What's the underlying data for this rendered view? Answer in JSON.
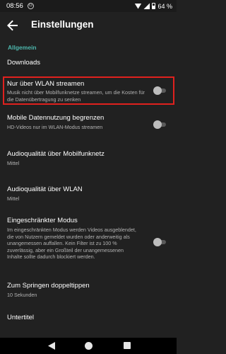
{
  "status_bar": {
    "time": "08:56",
    "notification_badge": "G",
    "battery_percent": "64 %",
    "icons": [
      "wifi-icon",
      "signal-icon",
      "battery-icon"
    ]
  },
  "app_bar": {
    "back_icon": "arrow-left-icon",
    "title": "Einstellungen"
  },
  "section": {
    "header": "Allgemein",
    "header_color": "#4db6ac"
  },
  "items": [
    {
      "title": "Downloads"
    },
    {
      "title": "Nur über WLAN streamen",
      "subtitle": "Musik nicht über Mobilfunknetze streamen, um die Kosten für die Datenübertragung zu senken",
      "toggle": false,
      "highlighted": true
    },
    {
      "title": "Mobile Datennutzung begrenzen",
      "subtitle": "HD-Videos nur im WLAN-Modus streamen",
      "toggle": false
    },
    {
      "title": "Audioqualität über Mobilfunknetz",
      "subtitle": "Mittel"
    },
    {
      "title": "Audioqualität über WLAN",
      "subtitle": "Mittel"
    },
    {
      "title": "Eingeschränkter Modus",
      "subtitle": "Im eingeschränkten Modus werden Videos ausgeblendet, die von Nutzern gemeldet wurden oder anderweitig als unangemessen auffallen. Kein Filter ist zu 100 % zuverlässig, aber ein Großteil der unangemessenen Inhalte sollte dadurch blockiert werden.",
      "toggle": false
    },
    {
      "title": "Zum Springen doppeltippen",
      "subtitle": "10 Sekunden"
    },
    {
      "title": "Untertitel"
    }
  ],
  "highlight_color": "#e0211e",
  "nav_bar": {
    "icons": [
      "back-triangle-icon",
      "home-circle-icon",
      "recents-square-icon"
    ]
  }
}
